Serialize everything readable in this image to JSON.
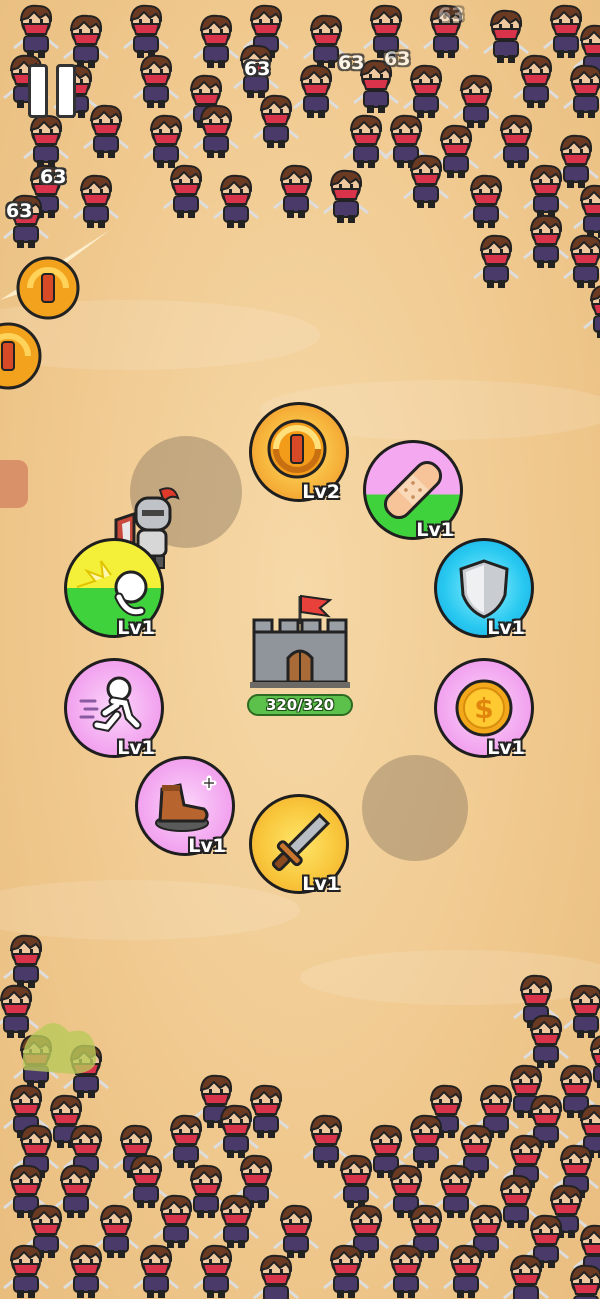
{
  "hud": {
    "pause_icon": "pause-icon",
    "damage_numbers": [
      "63",
      "63",
      "63",
      "63",
      "63",
      "63"
    ]
  },
  "castle": {
    "hp_text": "320/320",
    "hp_current": 320,
    "hp_max": 320,
    "hp_color": "#5cc14a"
  },
  "skills": [
    {
      "name": "spinning-blade",
      "icon": "spinning-blade-icon",
      "level": "Lv2"
    },
    {
      "name": "bandage",
      "icon": "bandage-icon",
      "level": "Lv1"
    },
    {
      "name": "shield",
      "icon": "shield-icon",
      "level": "Lv1"
    },
    {
      "name": "gold-coin",
      "icon": "coin-icon",
      "level": "Lv1"
    },
    {
      "name": "sword",
      "icon": "sword-icon",
      "level": "Lv1"
    },
    {
      "name": "boot-speed",
      "icon": "boot-icon",
      "level": "Lv1"
    },
    {
      "name": "running",
      "icon": "running-man-icon",
      "level": "Lv1"
    },
    {
      "name": "punch",
      "icon": "punch-icon",
      "level": "Lv1"
    }
  ],
  "colors": {
    "sand": "#f0c98f",
    "enemy_mask": "#d8334a",
    "enemy_hair": "#6a3a22",
    "enemy_body": "#4a3a6a"
  }
}
